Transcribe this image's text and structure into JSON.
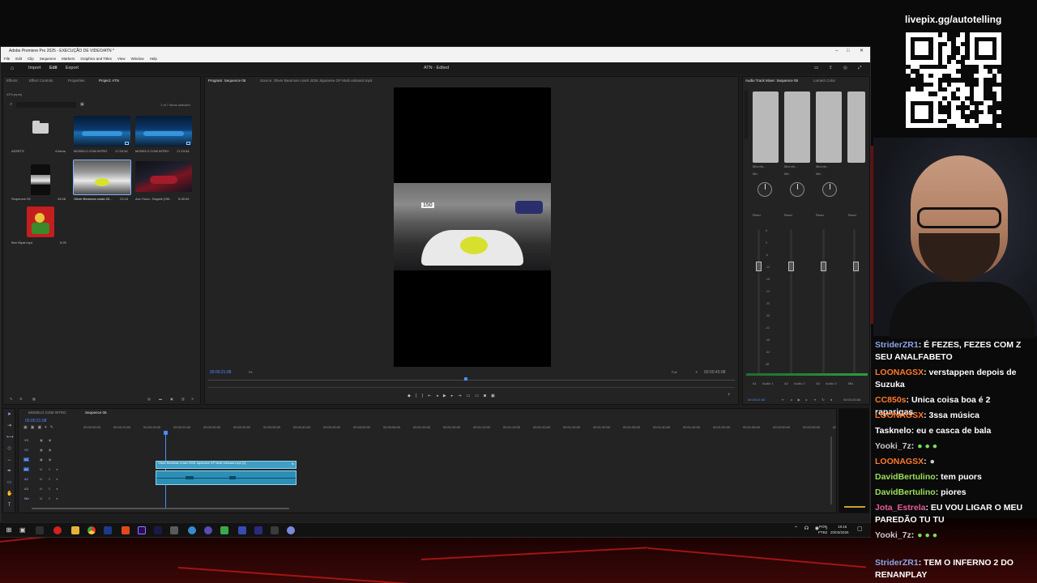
{
  "window": {
    "title": "Adobe Premiere Pro 2025 - EXECUÇÃO DE VIDEO/ATN *",
    "menu": [
      "File",
      "Edit",
      "Clip",
      "Sequence",
      "Markers",
      "Graphics and Titles",
      "View",
      "Window",
      "Help"
    ],
    "header": {
      "tabs": [
        "Import",
        "Edit",
        "Export"
      ],
      "active_tab": "Edit",
      "center_title": "ATN - Edited"
    }
  },
  "project_panel": {
    "tabs": [
      "Effects",
      "Effect Controls",
      "Properties",
      "Project: ATN"
    ],
    "active_tab": "Project: ATN",
    "project_file": "ATN.prproj",
    "selection_count": "1 of 7 items selected",
    "items": [
      {
        "name": "ASSETS",
        "meta": "4 items",
        "kind": "folder"
      },
      {
        "name": "MODELO COM INTRO",
        "meta": "17:19:34",
        "kind": "sequence"
      },
      {
        "name": "MODELO COM INTRO",
        "meta": "17:19:54",
        "kind": "sequence"
      },
      {
        "name": "Sequence 05",
        "meta": "43:08",
        "kind": "sequence"
      },
      {
        "name": "Oliver Bearman crash 20...",
        "meta": "23:16",
        "kind": "clip",
        "selected": true
      },
      {
        "name": "Ace Hood - Bugatti (Offi...",
        "meta": "5:08:09",
        "kind": "clip"
      },
      {
        "name": "Bee Blyat.mp4",
        "meta": "5:25",
        "kind": "clip"
      }
    ]
  },
  "program_monitor": {
    "tab": "Program: Sequence 05",
    "source": "Source: Oliver Bearman crash 2026 Japanese GP Multi onboard.mp4",
    "timecode": "00:00:21:08",
    "fit": "Fit",
    "quality": "Full",
    "duration": "00:00:43:08",
    "overlay_number": "150"
  },
  "mixer": {
    "tabs": [
      "Audio Track Mixer: Sequence 05",
      "Lumetri Color"
    ],
    "channels": [
      {
        "input": "Microfo...",
        "mode": "Read",
        "label": "A1",
        "name": "Audio 1"
      },
      {
        "input": "Microfo...",
        "mode": "Read",
        "label": "A2",
        "name": "Audio 2"
      },
      {
        "input": "Microfo...",
        "mode": "Read",
        "label": "A3",
        "name": "Audio 3"
      },
      {
        "input": "",
        "mode": "Read",
        "label": "Mix",
        "name": "Mix"
      }
    ],
    "mix_label": "Mix",
    "gain": "0.0",
    "scale": [
      "6",
      "0",
      "-6",
      "-12",
      "-18",
      "-24",
      "-30",
      "-36",
      "-42",
      "-48",
      "-54",
      "dB"
    ],
    "timecode_left": "00:00:21:08",
    "timecode_right": "00:00:43:08"
  },
  "timeline": {
    "tabs": [
      "MODELO COM INTRO",
      "Sequence 05"
    ],
    "active_tab": "Sequence 05",
    "timecode": "00:00:21:08",
    "ruler": [
      "00:00:05:00",
      "00:00:10:00",
      "00:00:15:00",
      "00:00:20:00",
      "00:00:25:00",
      "00:00:30:00",
      "00:00:35:00",
      "00:00:40:00",
      "00:00:45:00",
      "00:00:50:00",
      "00:00:55:00",
      "00:01:00:00",
      "00:01:05:00",
      "00:01:10:00",
      "00:01:15:00",
      "00:01:20:00",
      "00:01:25:00",
      "00:01:30:00",
      "00:01:35:00",
      "00:01:40:00",
      "00:01:45:00",
      "00:01:50:00",
      "00:01:55:00",
      "00:02:00:00",
      "00:02:05:00",
      "00:02:10:00"
    ],
    "tracks": [
      "V3",
      "V2",
      "V1",
      "A1",
      "A2",
      "A3",
      "Mix"
    ],
    "clip_label": "Oliver Bearman crash 2026 Japanese GP Multi onboard.mp4 [V]",
    "mix_value": "0.0"
  },
  "taskbar": {
    "lang": "POR",
    "lang2": "PTB2",
    "time": "19:15",
    "date": "20/03/2026"
  },
  "stream": {
    "url": "livepix.gg/autotelling"
  },
  "chat": [
    {
      "user": "StriderZR1",
      "color": "#8aa6e6",
      "text": ": É FEZES, FEZES COM Z SEU ANALFABETO"
    },
    {
      "user": "LOONAGSX",
      "color": "#ff7a2a",
      "text": ": verstappen depois de Suzuka"
    },
    {
      "user": "CC850s",
      "color": "#ff7a2a",
      "text": ": Unica coisa boa é 2 raparigas"
    },
    {
      "user": "LOONAGSX",
      "color": "#ff7a2a",
      "text": ": 3ssa música"
    },
    {
      "user": "Tasknelo",
      "color": "#ffffff",
      "text": ": eu e casca de bala"
    },
    {
      "user": "Yooki_7z",
      "color": "#c8c8c8",
      "text": ":"
    },
    {
      "user": "LOONAGSX",
      "color": "#ff7a2a",
      "text": ":"
    },
    {
      "user": "DavidBertulino",
      "color": "#9be05a",
      "text": ": tem puors"
    },
    {
      "user": "DavidBertulino",
      "color": "#9be05a",
      "text": ": piores"
    },
    {
      "user": "Jota_Estrela",
      "color": "#e85b9a",
      "text": ": EU VOU LIGAR O MEU PAREDÃO TU TU"
    },
    {
      "user": "Yooki_7z",
      "color": "#c8c8c8",
      "text": ":"
    },
    {
      "user": "StriderZR1",
      "color": "#8aa6e6",
      "text": ": TEM O INFERNO 2 DO RENANPLAY"
    }
  ],
  "icons": [
    "home-icon",
    "search-icon",
    "folder-icon",
    "play-icon",
    "step-back-icon",
    "step-forward-icon",
    "wrench-icon",
    "selection-tool-icon",
    "razor-tool-icon",
    "pen-tool-icon",
    "hand-tool-icon",
    "type-tool-icon",
    "windows-icon",
    "chrome-icon",
    "qr-code-icon"
  ]
}
